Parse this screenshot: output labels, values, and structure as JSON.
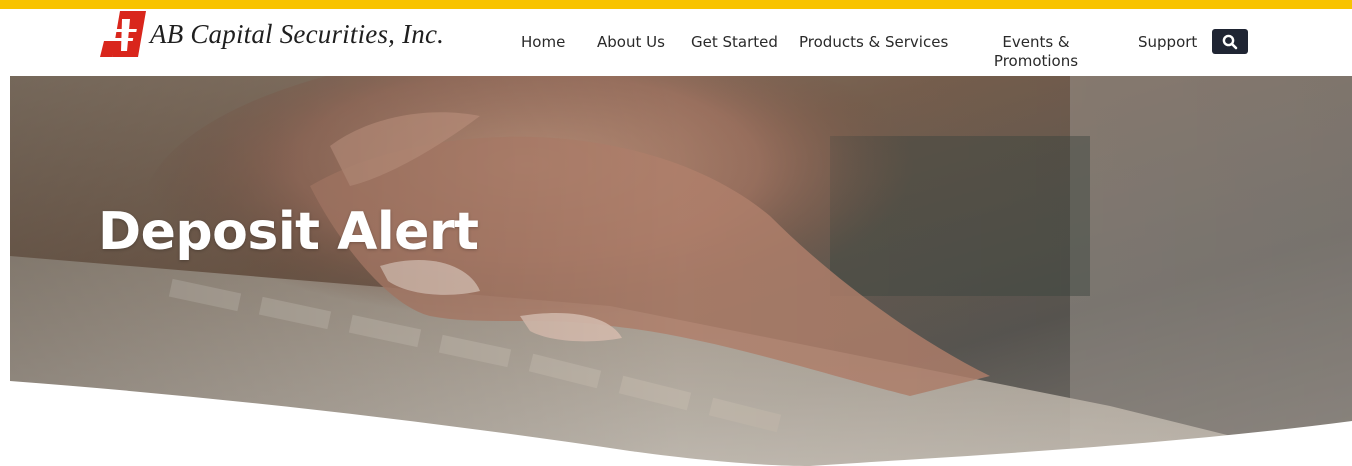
{
  "brand": {
    "name": "AB Capital Securities, Inc.",
    "top_bar_color": "#f8c300",
    "logo_color": "#d9261c"
  },
  "nav": {
    "home": "Home",
    "about": "About Us",
    "get_started": "Get Started",
    "products": "Products & Services",
    "events_line1": "Events &",
    "events_line2": "Promotions",
    "support": "Support"
  },
  "search": {
    "icon": "search-icon"
  },
  "hero": {
    "title": "Deposit Alert",
    "image": "hands-typing-on-keyboard"
  }
}
